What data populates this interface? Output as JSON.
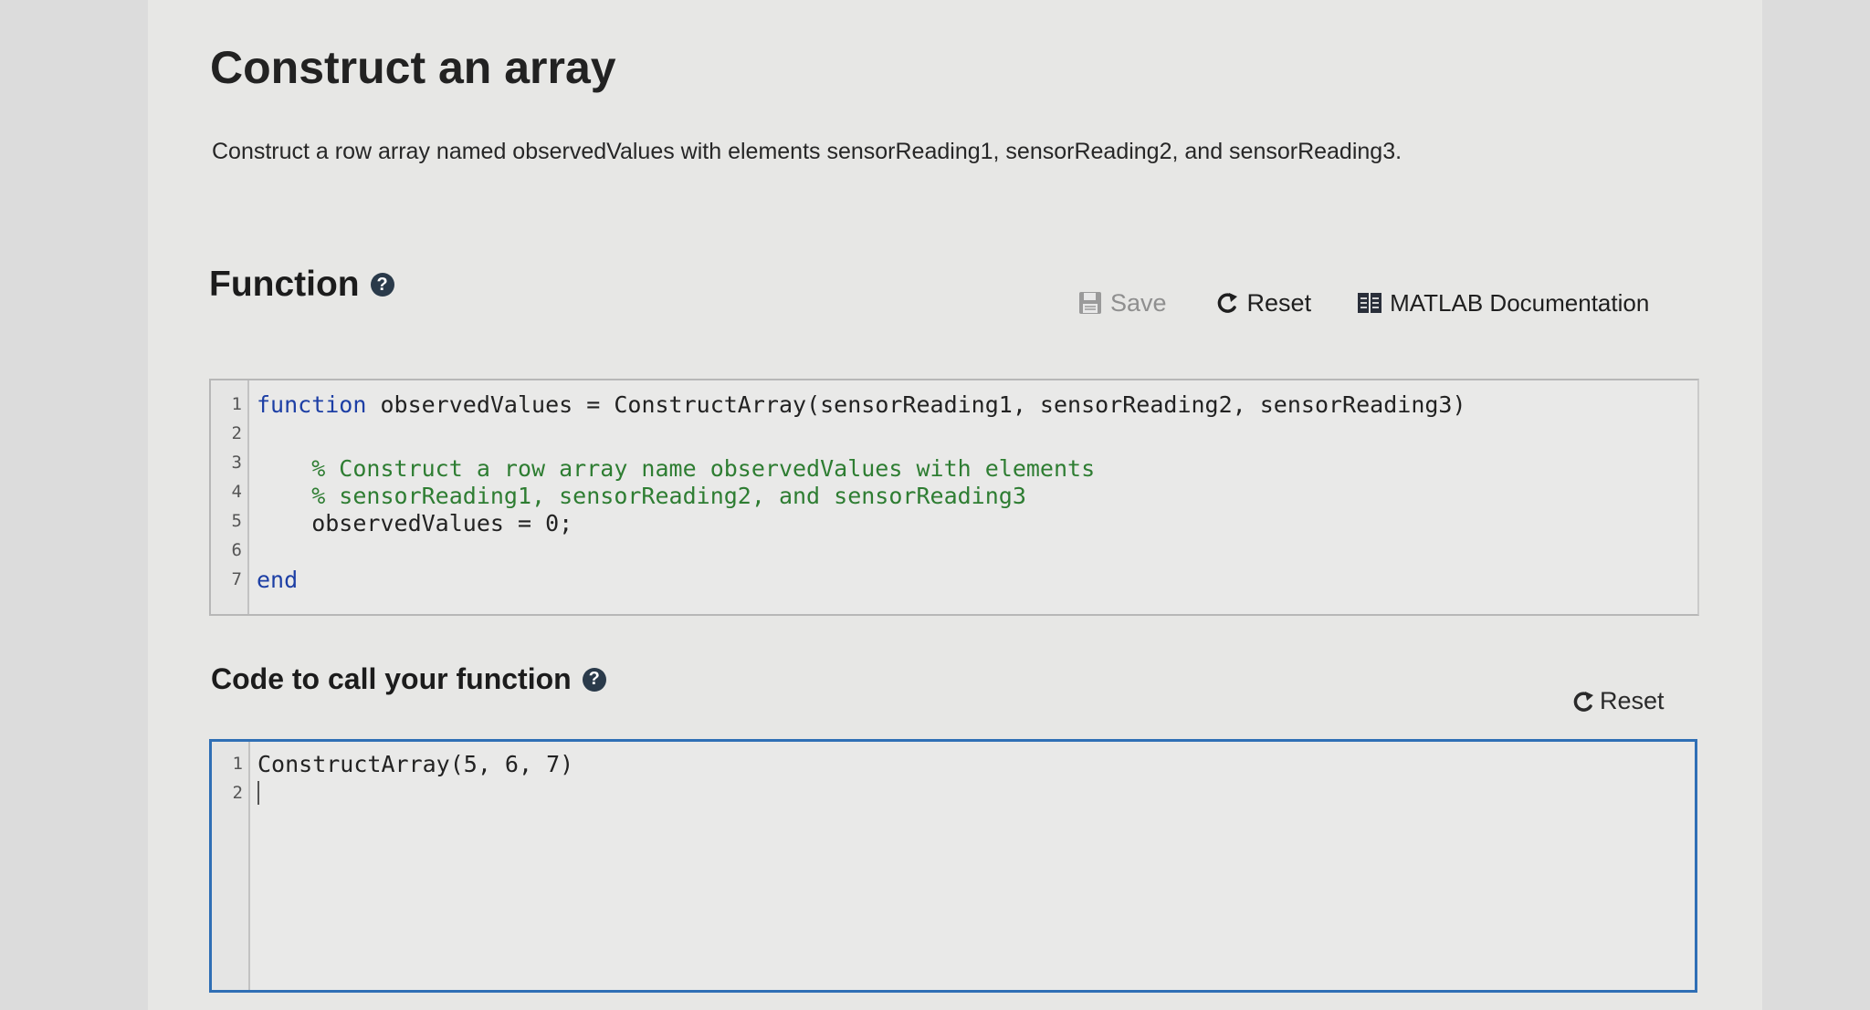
{
  "title": "Construct an array",
  "description": "Construct a row array named observedValues with elements sensorReading1, sensorReading2, and sensorReading3.",
  "function_section": {
    "heading": "Function",
    "help_glyph": "?",
    "toolbar": {
      "save_label": "Save",
      "reset_label": "Reset",
      "doc_label": "MATLAB Documentation"
    },
    "editor": {
      "line_numbers": [
        "1",
        "2",
        "3",
        "4",
        "5",
        "6",
        "7"
      ],
      "lines": {
        "l1_keyword": "function",
        "l1_code": " observedValues = ConstructArray(sensorReading1, sensorReading2, sensorReading3)",
        "l3_comment": "    % Construct a row array name observedValues with elements",
        "l4_comment": "    % sensorReading1, sensorReading2, and sensorReading3",
        "l5_code": "    observedValues = 0;",
        "l7_keyword": "end"
      }
    }
  },
  "call_section": {
    "heading": "Code to call your function",
    "help_glyph": "?",
    "reset_label": "Reset",
    "editor": {
      "line_numbers": [
        "1",
        "2"
      ],
      "l1_code": "ConstructArray(5, 6, 7)"
    }
  },
  "colors": {
    "keyword": "#1d3fa5",
    "comment": "#2e7d32",
    "active_border": "#2f6fb5"
  },
  "icons": [
    "help-icon",
    "save-icon",
    "reset-icon",
    "documentation-icon"
  ]
}
